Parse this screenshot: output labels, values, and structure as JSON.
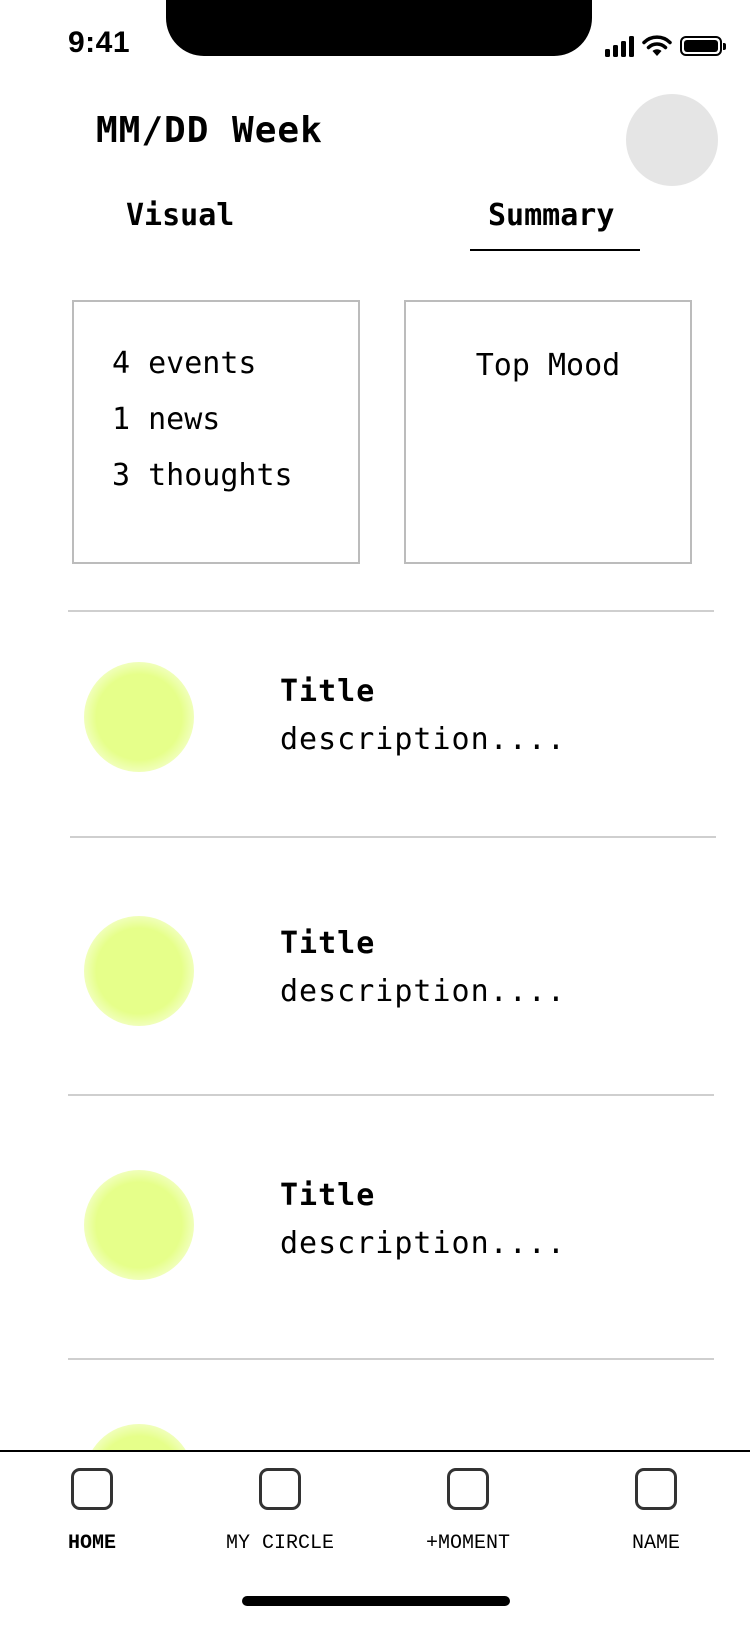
{
  "status_bar": {
    "time": "9:41",
    "icons": [
      "signal-icon",
      "wifi-icon",
      "battery-icon"
    ]
  },
  "header": {
    "title": "MM/DD Week"
  },
  "tabs": [
    {
      "label": "Visual",
      "active": false
    },
    {
      "label": "Summary",
      "active": true
    }
  ],
  "summary": {
    "stats": [
      "4 events",
      "1 news",
      "3 thoughts"
    ],
    "mood_label": "Top Mood"
  },
  "items": [
    {
      "title": "Title",
      "description": "description...."
    },
    {
      "title": "Title",
      "description": "description...."
    },
    {
      "title": "Title",
      "description": "description...."
    }
  ],
  "nav": [
    {
      "label": "HOME",
      "icon": "home-icon",
      "active": true
    },
    {
      "label": "MY CIRCLE",
      "icon": "circle-icon",
      "active": false
    },
    {
      "label": "+MOMENT",
      "icon": "moment-icon",
      "active": false
    },
    {
      "label": "NAME",
      "icon": "profile-icon",
      "active": false
    }
  ],
  "colors": {
    "accent": "#e6ff8a",
    "avatar": "#e5e5e5",
    "border": "#bcbcbc"
  }
}
